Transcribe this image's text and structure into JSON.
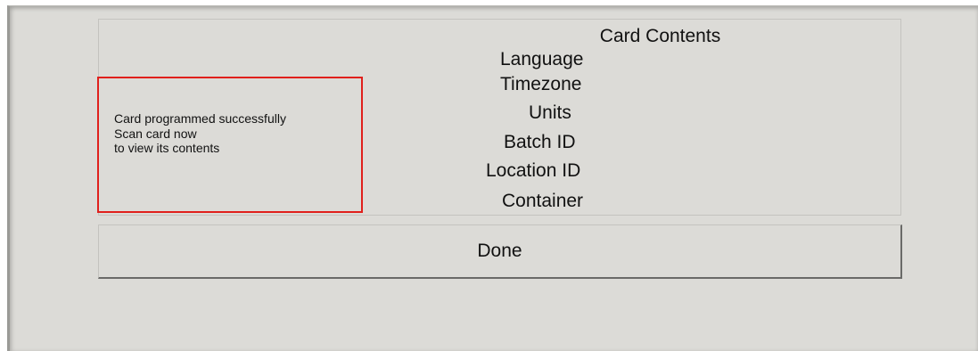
{
  "card_contents": {
    "title": "Card Contents",
    "fields": [
      "Language",
      "Timezone",
      "Units",
      "Batch ID",
      "Location ID",
      "Container"
    ]
  },
  "message": {
    "lines": [
      "Card programmed successfully",
      "Scan card now",
      "to view its contents"
    ],
    "highlight_color": "#e0201c"
  },
  "done_button": {
    "label": "Done"
  }
}
